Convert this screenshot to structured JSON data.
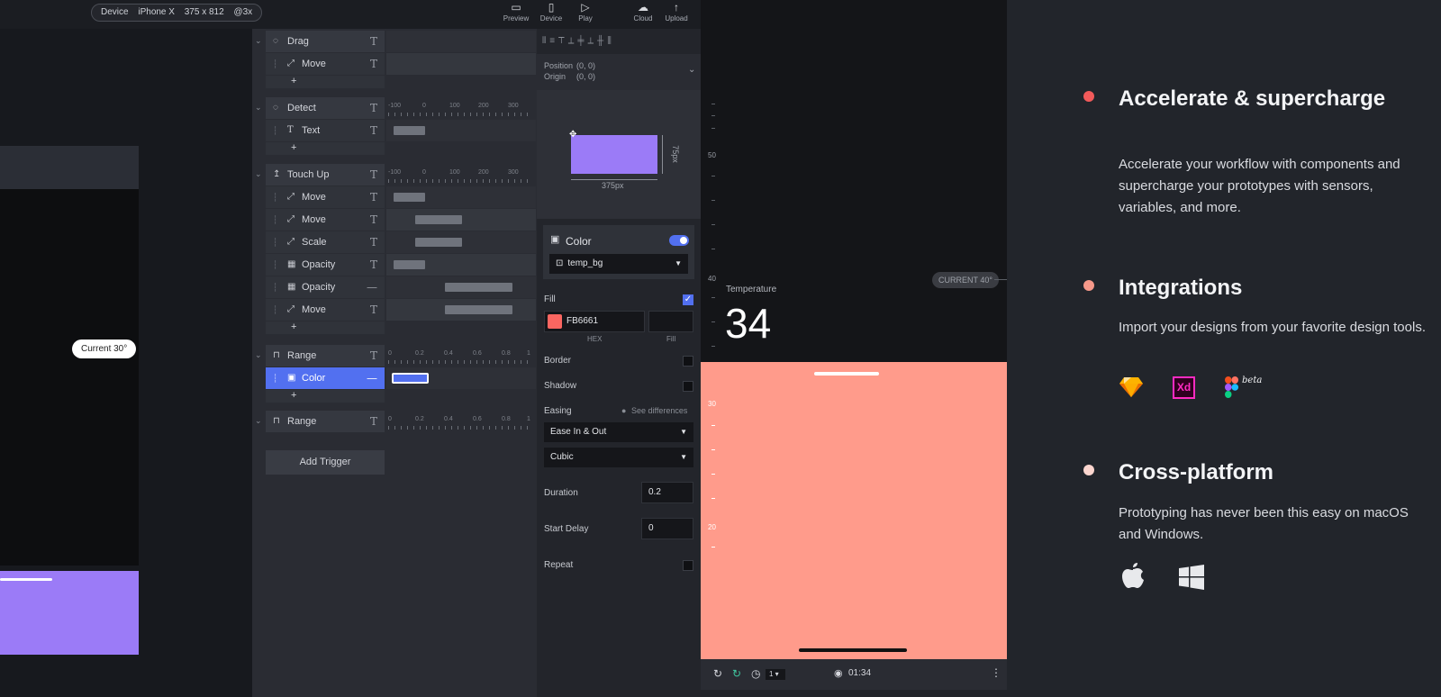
{
  "topbar": {
    "device_label": "Device",
    "device_model": "iPhone X",
    "device_size": "375 x 812",
    "device_scale": "@3x",
    "buttons": [
      {
        "label": "Preview",
        "icon": "monitor-icon"
      },
      {
        "label": "Device",
        "icon": "phone-icon"
      },
      {
        "label": "Play",
        "icon": "play-icon"
      },
      {
        "label": "Cloud",
        "icon": "cloud-icon"
      },
      {
        "label": "Upload",
        "icon": "upload-arrow-icon"
      }
    ]
  },
  "canvas": {
    "current_pill": "Current 30°"
  },
  "triggers": {
    "groups": [
      {
        "name": "Drag",
        "children": [
          "Move"
        ]
      },
      {
        "name": "Detect",
        "children": [
          "Text"
        ]
      },
      {
        "name": "Touch Up",
        "children": [
          "Move",
          "Move",
          "Scale",
          "Opacity",
          "Opacity",
          "Move"
        ]
      },
      {
        "name": "Range",
        "children": [
          "Color"
        ]
      },
      {
        "name": "Range",
        "children": []
      }
    ],
    "plus": "+",
    "add_trigger": "Add Trigger",
    "ruler_px": [
      "-100",
      "0",
      "100",
      "200",
      "300"
    ],
    "ruler_range": [
      "0",
      "0.2",
      "0.4",
      "0.6",
      "0.8",
      "1"
    ]
  },
  "properties": {
    "position_label": "Position",
    "position_value": "(0, 0)",
    "origin_label": "Origin",
    "origin_value": "(0, 0)",
    "width_label": "375px",
    "height_label": "75px",
    "color_title": "Color",
    "color_variable": "temp_bg",
    "fill_label": "Fill",
    "hex_value": "FB6661",
    "hex_caption": "HEX",
    "fill_caption": "Fill",
    "fill_color": "#fb6661",
    "border_label": "Border",
    "shadow_label": "Shadow",
    "easing_label": "Easing",
    "see_differences": "See differences",
    "easing_value": "Ease In & Out",
    "curve_value": "Cubic",
    "duration_label": "Duration",
    "duration_value": "0.2",
    "start_delay_label": "Start Delay",
    "start_delay_value": "0",
    "repeat_label": "Repeat"
  },
  "device": {
    "temperature_label": "Temperature",
    "temperature_value": "34",
    "current_pill": "CURRENT 40°",
    "ruler_labels": [
      "50",
      "40",
      "30",
      "20"
    ],
    "footer_speed": "1",
    "footer_time": "01:34",
    "bg_color": "#ff9b8b"
  },
  "features": [
    {
      "title": "Accelerate & supercharge",
      "body": "Accelerate your workflow with components and supercharge your prototypes with sensors, variables, and more.",
      "dot_color": "#f25a5a"
    },
    {
      "title": "Integrations",
      "body": "Import your designs from your favorite design tools.",
      "dot_color": "#f7998a",
      "logos": [
        "sketch-logo",
        "xd-logo",
        "figma-logo"
      ],
      "figma_badge": "beta",
      "xd_text": "Xd"
    },
    {
      "title": "Cross-platform",
      "body": "Prototyping has never been this easy on macOS and Windows.",
      "dot_color": "#fcd6cf",
      "logos": [
        "apple-logo",
        "windows-logo"
      ]
    }
  ]
}
